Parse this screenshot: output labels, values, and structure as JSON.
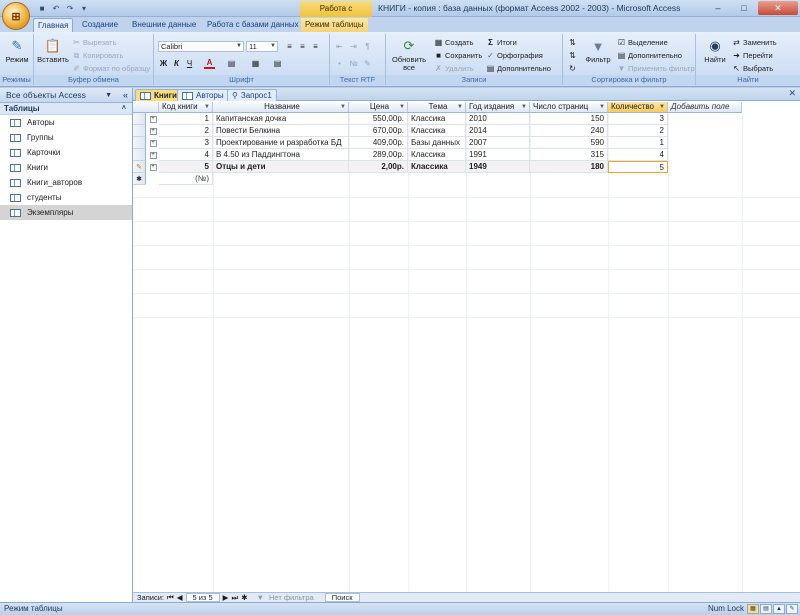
{
  "app": {
    "context_tab_title": "Работа с таблицами",
    "window_title": "КНИГИ - копия : база данных (формат Access 2002 - 2003) - Microsoft Access",
    "office_button": "⊞",
    "window_controls": [
      "–",
      "□",
      "✕"
    ]
  },
  "ribbon_tabs": [
    "Главная",
    "Создание",
    "Внешние данные",
    "Работа с базами данных",
    "Режим таблицы"
  ],
  "ribbon": {
    "modes": {
      "view_label": "Режим",
      "group_label": "Режимы"
    },
    "clipboard": {
      "paste_label": "Вставить",
      "cut_label": "Вырезать",
      "copy_label": "Копировать",
      "format_painter_label": "Формат по образцу",
      "group_label": "Буфер обмена"
    },
    "font": {
      "font_name": "Calibri",
      "font_size": "11",
      "bold": "Ж",
      "italic": "К",
      "underline": "Ч",
      "font_color": "A",
      "group_label": "Шрифт"
    },
    "rtf": {
      "group_label": "Текст RTF"
    },
    "records": {
      "refresh_label": "Обновить все",
      "new_label": "Создать",
      "save_label": "Сохранить",
      "delete_label": "Удалить",
      "totals_label": "Итоги",
      "spelling_label": "Орфография",
      "more_label": "Дополнительно",
      "group_label": "Записи"
    },
    "sort_filter": {
      "filter_label": "Фильтр",
      "selection_label": "Выделение",
      "advanced_label": "Дополнительно",
      "toggle_filter_label": "Применить фильтр",
      "group_label": "Сортировка и фильтр"
    },
    "find": {
      "find_label": "Найти",
      "replace_label": "Заменить",
      "goto_label": "Перейти",
      "select_label": "Выбрать",
      "group_label": "Найти"
    }
  },
  "nav": {
    "header": "Все объекты Access",
    "group": "Таблицы",
    "items": [
      "Авторы",
      "Группы",
      "Карточки",
      "Книги",
      "Книги_авторов",
      "студенты",
      "Экземпляры"
    ],
    "selected_index": 6
  },
  "doc_tabs": [
    "Книги",
    "Авторы",
    "Запрос1"
  ],
  "table": {
    "columns": [
      "Код книги",
      "Название",
      "Цена",
      "Тема",
      "Год издания",
      "Число страниц",
      "Количество",
      "Добавить поле"
    ],
    "rows": [
      [
        "1",
        "Капитанская дочка",
        "550,00р.",
        "Классика",
        "2010",
        "150",
        "3"
      ],
      [
        "2",
        "Повести Белкина",
        "670,00р.",
        "Классика",
        "2014",
        "240",
        "2"
      ],
      [
        "3",
        "Проектирование и разработка БД",
        "409,00р.",
        "Базы данных",
        "2007",
        "590",
        "1"
      ],
      [
        "4",
        "В 4.50 из Паддингтона",
        "289,00р.",
        "Классика",
        "1991",
        "315",
        "4"
      ],
      [
        "5",
        "Отцы и дети",
        "2,00р.",
        "Классика",
        "1949",
        "180",
        "5"
      ]
    ],
    "new_row_placeholder": "(№)",
    "current_row_index": 4
  },
  "record_nav": {
    "label": "Записи:",
    "position": "5 из 5",
    "filter_label": "Нет фильтра",
    "search_label": "Поиск"
  },
  "status": {
    "mode": "Режим таблицы",
    "numlock": "Num Lock"
  },
  "colors": {
    "accent": "#fbdd7b",
    "ribbon": "#d3e2f6",
    "frame": "#b9cde5"
  }
}
